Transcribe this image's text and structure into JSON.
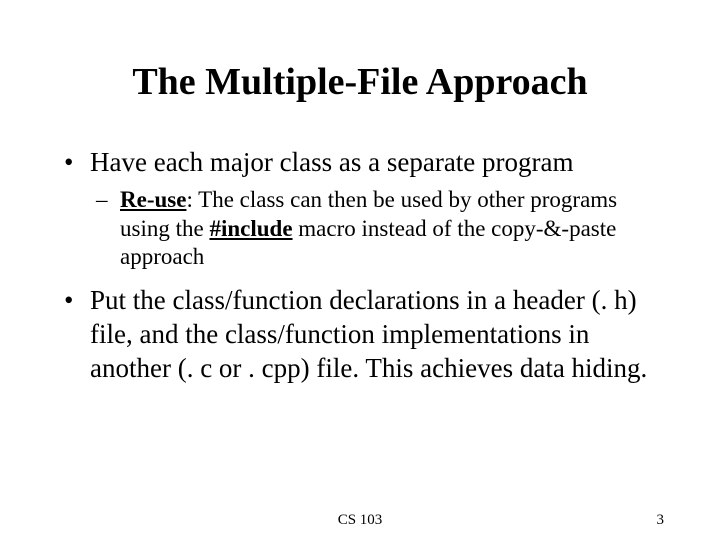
{
  "title": "The Multiple-File Approach",
  "bullets": [
    {
      "text": "Have each major class as a separate program",
      "sub": {
        "lead": "Re-use",
        "before_include": ": The class can then be used by other programs using the ",
        "include": "#include",
        "after_include": " macro instead of the copy-&-paste approach"
      }
    },
    {
      "text": "Put the class/function declarations in a header (. h) file, and the class/function implementations in another (. c or . cpp) file. This achieves data hiding."
    }
  ],
  "footer": {
    "course": "CS 103",
    "page": "3"
  }
}
